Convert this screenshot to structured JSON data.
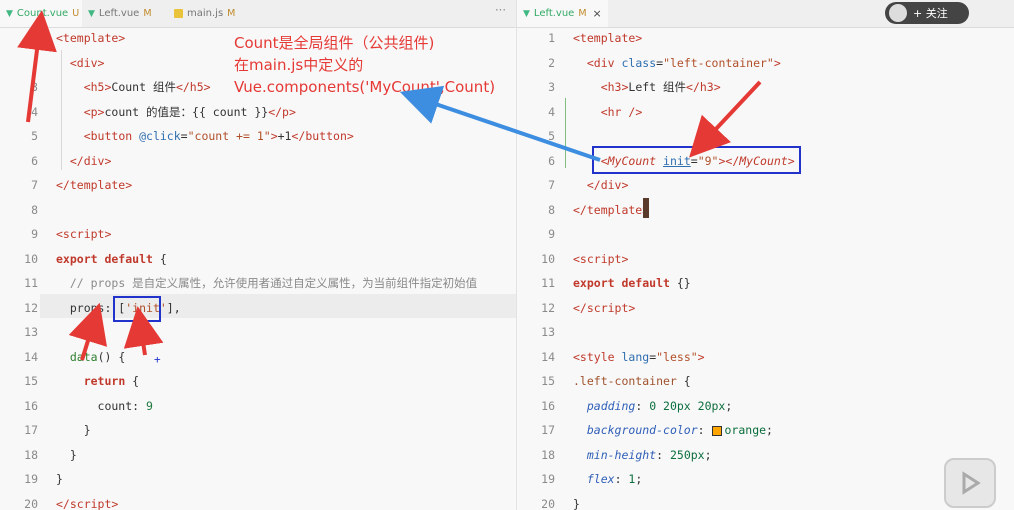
{
  "left": {
    "tabs": [
      {
        "label": "Count.vue",
        "badge": "U",
        "type": "vue",
        "active": true
      },
      {
        "label": "Left.vue",
        "badge": "M",
        "type": "vue",
        "active": false
      },
      {
        "label": "main.js",
        "badge": "M",
        "type": "js",
        "active": false
      }
    ],
    "more": "···",
    "lines": [
      {
        "num": "",
        "html": "<span class='t'>&lt;template&gt;</span>"
      },
      {
        "num": "",
        "html": "  <span class='t'>&lt;div&gt;</span>"
      },
      {
        "num": "3",
        "html": "    <span class='t'>&lt;h5&gt;</span>Count 组件<span class='t'>&lt;/h5&gt;</span>"
      },
      {
        "num": "4",
        "html": "    <span class='t'>&lt;p&gt;</span>count 的值是：{{ count }}<span class='t'>&lt;/p&gt;</span>"
      },
      {
        "num": "5",
        "html": "    <span class='t'>&lt;button</span> <span class='a'>@click</span>=<span class='s'>\"count += 1\"</span><span class='t'>&gt;</span>+1<span class='t'>&lt;/button&gt;</span>"
      },
      {
        "num": "6",
        "html": "  <span class='t'>&lt;/div&gt;</span>"
      },
      {
        "num": "7",
        "html": "<span class='t'>&lt;/template&gt;</span>"
      },
      {
        "num": "8",
        "html": ""
      },
      {
        "num": "9",
        "html": "<span class='t'>&lt;script&gt;</span>"
      },
      {
        "num": "10",
        "html": "<span class='k'>export default</span> {"
      },
      {
        "num": "11",
        "html": "  <span class='c'>// props 是自定义属性，允许使用者通过自定义属性，为当前组件指定初始值</span>"
      },
      {
        "num": "12",
        "html": "  props: [<span class='s'>'init'</span>],"
      },
      {
        "num": "13",
        "html": ""
      },
      {
        "num": "14",
        "html": "  <span class='f'>data</span>() {"
      },
      {
        "num": "15",
        "html": "    <span class='k'>return</span> {"
      },
      {
        "num": "16",
        "html": "      count: <span class='n'>9</span>"
      },
      {
        "num": "17",
        "html": "    }"
      },
      {
        "num": "18",
        "html": "  }"
      },
      {
        "num": "19",
        "html": "}"
      },
      {
        "num": "20",
        "html": "<span class='t'>&lt;/script&gt;</span>"
      }
    ]
  },
  "right": {
    "tabs": [
      {
        "label": "Left.vue",
        "badge": "M",
        "type": "vue",
        "active": true
      }
    ],
    "lines": [
      {
        "num": "1",
        "html": "<span class='t'>&lt;template&gt;</span>"
      },
      {
        "num": "2",
        "html": "  <span class='t'>&lt;div</span> <span class='a'>class</span>=<span class='s'>\"left-container\"</span><span class='t'>&gt;</span>"
      },
      {
        "num": "3",
        "html": "    <span class='t'>&lt;h3&gt;</span>Left 组件<span class='t'>&lt;/h3&gt;</span>"
      },
      {
        "num": "4",
        "html": "    <span class='t'>&lt;hr /&gt;</span>"
      },
      {
        "num": "5",
        "html": ""
      },
      {
        "num": "6",
        "html": "    <span class='t'>&lt;<i>MyCount</i></span> <span class='a' style='text-decoration:underline'>init</span>=<span class='s'>\"9\"</span><span class='t'>&gt;&lt;/<i>MyCount</i>&gt;</span>"
      },
      {
        "num": "7",
        "html": "  <span class='t'>&lt;/div&gt;</span>"
      },
      {
        "num": "8",
        "html": "<span class='t'>&lt;/template&gt;</span>"
      },
      {
        "num": "9",
        "html": ""
      },
      {
        "num": "10",
        "html": "<span class='t'>&lt;script&gt;</span>"
      },
      {
        "num": "11",
        "html": "<span class='k'>export default</span> {}"
      },
      {
        "num": "12",
        "html": "<span class='t'>&lt;/script&gt;</span>"
      },
      {
        "num": "13",
        "html": ""
      },
      {
        "num": "14",
        "html": "<span class='t'>&lt;style</span> <span class='a'>lang</span>=<span class='s'>\"less\"</span><span class='t'>&gt;</span>"
      },
      {
        "num": "15",
        "html": "<span class='sel'>.left-container</span> {"
      },
      {
        "num": "16",
        "html": "  <span class='p'>padding</span>: <span class='v'>0 20px 20px</span>;"
      },
      {
        "num": "17",
        "html": "  <span class='p'>background-color</span>: <span class='swatch'></span><span class='v'>orange</span>;"
      },
      {
        "num": "18",
        "html": "  <span class='p'>min-height</span>: <span class='v'>250px</span>;"
      },
      {
        "num": "19",
        "html": "  <span class='p'>flex</span>: <span class='v'>1</span>;"
      },
      {
        "num": "20",
        "html": "}"
      }
    ]
  },
  "annotation": {
    "lines": [
      "Count是全局组件（公共组件)",
      "在main.js中定义的",
      "Vue.components('MyCount',Count)"
    ]
  },
  "overlay": {
    "follow_label": "+ 关注"
  }
}
